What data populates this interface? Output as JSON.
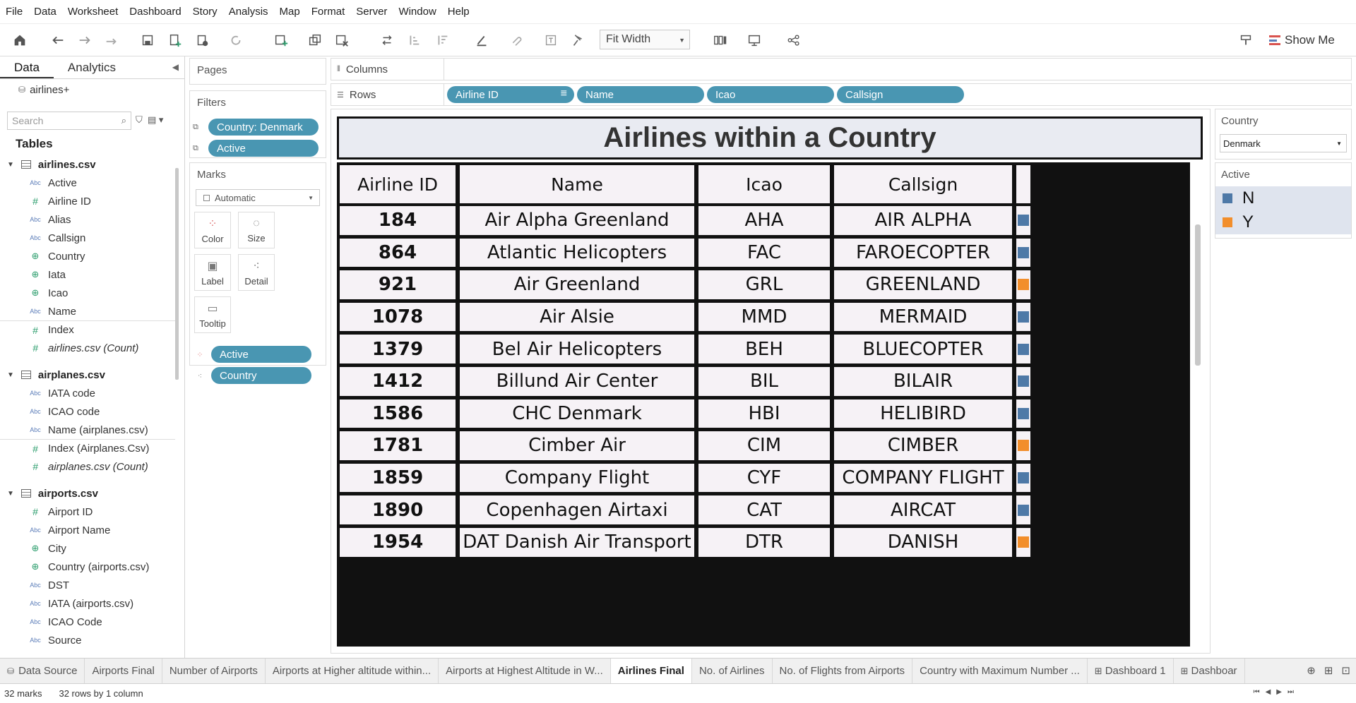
{
  "menu": [
    "File",
    "Data",
    "Worksheet",
    "Dashboard",
    "Story",
    "Analysis",
    "Map",
    "Format",
    "Server",
    "Window",
    "Help"
  ],
  "toolbar": {
    "fit": "Fit Width",
    "show_me": "Show Me"
  },
  "data_pane": {
    "tabs": [
      "Data",
      "Analytics"
    ],
    "source": "airlines+",
    "search_placeholder": "Search",
    "tables_title": "Tables",
    "tables": [
      {
        "name": "airlines.csv",
        "fields": [
          {
            "name": "Active",
            "type": "Abc"
          },
          {
            "name": "Airline ID",
            "type": "#"
          },
          {
            "name": "Alias",
            "type": "Abc"
          },
          {
            "name": "Callsign",
            "type": "Abc"
          },
          {
            "name": "Country",
            "type": "geo"
          },
          {
            "name": "Iata",
            "type": "geo"
          },
          {
            "name": "Icao",
            "type": "geo"
          },
          {
            "name": "Name",
            "type": "Abc"
          },
          {
            "name": "Index",
            "type": "#",
            "sep": true
          },
          {
            "name": "airlines.csv (Count)",
            "type": "#",
            "italic": true
          }
        ]
      },
      {
        "name": "airplanes.csv",
        "fields": [
          {
            "name": "IATA code",
            "type": "Abc"
          },
          {
            "name": "ICAO code",
            "type": "Abc"
          },
          {
            "name": "Name (airplanes.csv)",
            "type": "Abc"
          },
          {
            "name": "Index (Airplanes.Csv)",
            "type": "#",
            "sep": true
          },
          {
            "name": "airplanes.csv (Count)",
            "type": "#",
            "italic": true
          }
        ]
      },
      {
        "name": "airports.csv",
        "fields": [
          {
            "name": "Airport ID",
            "type": "#"
          },
          {
            "name": "Airport Name",
            "type": "Abc"
          },
          {
            "name": "City",
            "type": "geo"
          },
          {
            "name": "Country (airports.csv)",
            "type": "geo"
          },
          {
            "name": "DST",
            "type": "Abc"
          },
          {
            "name": "IATA (airports.csv)",
            "type": "Abc"
          },
          {
            "name": "ICAO Code",
            "type": "Abc"
          },
          {
            "name": "Source",
            "type": "Abc"
          }
        ]
      }
    ]
  },
  "cards": {
    "pages": "Pages",
    "filters": "Filters",
    "filter_pills": [
      "Country: Denmark",
      "Active"
    ],
    "marks": "Marks",
    "mark_type": "Automatic",
    "mark_buttons": [
      "Color",
      "Size",
      "Label",
      "Detail",
      "Tooltip"
    ],
    "mark_pills": [
      "Active",
      "Country"
    ]
  },
  "shelves": {
    "columns": "Columns",
    "rows": "Rows",
    "row_pills": [
      "Airline ID",
      "Name",
      "Icao",
      "Callsign"
    ]
  },
  "view": {
    "title": "Airlines within a Country",
    "headers": [
      "Airline ID",
      "Name",
      "Icao",
      "Callsign"
    ],
    "rows": [
      {
        "id": "184",
        "name": "Air Alpha Greenland",
        "icao": "AHA",
        "callsign": "AIR ALPHA",
        "active": "N"
      },
      {
        "id": "864",
        "name": "Atlantic Helicopters",
        "icao": "FAC",
        "callsign": "FAROECOPTER",
        "active": "N"
      },
      {
        "id": "921",
        "name": "Air Greenland",
        "icao": "GRL",
        "callsign": "GREENLAND",
        "active": "Y"
      },
      {
        "id": "1078",
        "name": "Air Alsie",
        "icao": "MMD",
        "callsign": "MERMAID",
        "active": "N"
      },
      {
        "id": "1379",
        "name": "Bel Air Helicopters",
        "icao": "BEH",
        "callsign": "BLUECOPTER",
        "active": "N"
      },
      {
        "id": "1412",
        "name": "Billund Air Center",
        "icao": "BIL",
        "callsign": "BILAIR",
        "active": "N"
      },
      {
        "id": "1586",
        "name": "CHC Denmark",
        "icao": "HBI",
        "callsign": "HELIBIRD",
        "active": "N"
      },
      {
        "id": "1781",
        "name": "Cimber Air",
        "icao": "CIM",
        "callsign": "CIMBER",
        "active": "Y"
      },
      {
        "id": "1859",
        "name": "Company Flight",
        "icao": "CYF",
        "callsign": "COMPANY FLIGHT",
        "active": "N"
      },
      {
        "id": "1890",
        "name": "Copenhagen Airtaxi",
        "icao": "CAT",
        "callsign": "AIRCAT",
        "active": "N"
      },
      {
        "id": "1954",
        "name": "DAT Danish Air Transport",
        "icao": "DTR",
        "callsign": "DANISH",
        "active": "Y"
      }
    ]
  },
  "legends": {
    "country_title": "Country",
    "country_value": "Denmark",
    "active_title": "Active",
    "active_items": [
      {
        "label": "N",
        "color": "#4e79a7"
      },
      {
        "label": "Y",
        "color": "#f28e2b"
      }
    ]
  },
  "sheet_tabs": {
    "data_source": "Data Source",
    "sheets": [
      "Airports Final",
      "Number of Airports",
      "Airports at Higher altitude within...",
      "Airports at Highest Altitude in W...",
      "Airlines Final",
      "No. of Airlines",
      "No. of Flights from Airports",
      "Country with Maximum Number ...",
      "Dashboard 1",
      "Dashboar"
    ],
    "active": "Airlines Final"
  },
  "status": {
    "marks": "32 marks",
    "rows": "32 rows by 1 column"
  }
}
